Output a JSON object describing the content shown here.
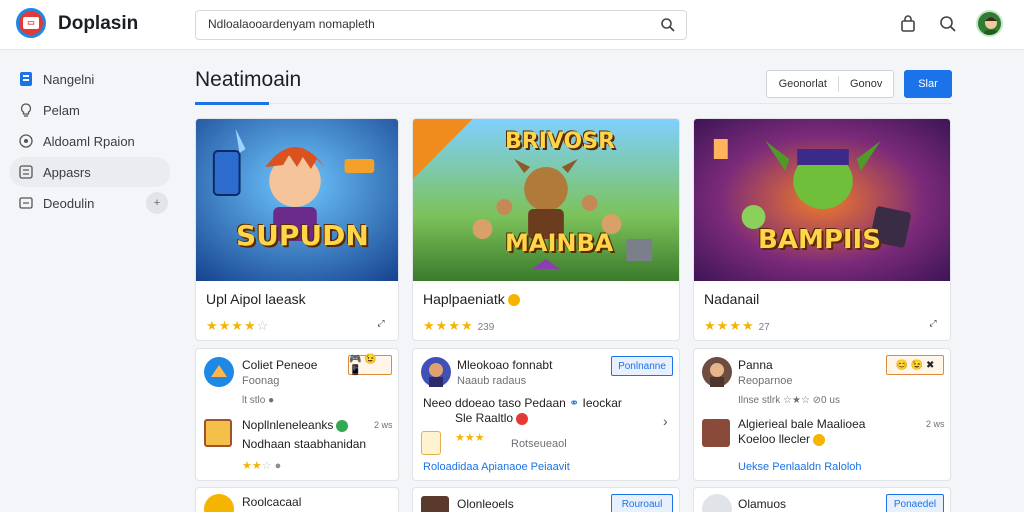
{
  "header": {
    "app_title": "Doplasin",
    "search_value": "Ndloalaooardenyam nomapleth",
    "icons": [
      "logo-icon",
      "search-icon",
      "bag-icon",
      "search-icon",
      "avatar"
    ]
  },
  "sidebar": {
    "items": [
      {
        "label": "Nangelni",
        "icon": "page-icon",
        "active": false
      },
      {
        "label": "Pelam",
        "icon": "bulb-icon",
        "active": false
      },
      {
        "label": "Aldoaml Rpaion",
        "icon": "compass-icon",
        "active": false
      },
      {
        "label": "Appasrs",
        "icon": "apps-icon",
        "active": true
      },
      {
        "label": "Deodulin",
        "icon": "box-icon",
        "active": false,
        "action": "+"
      }
    ]
  },
  "main": {
    "title": "Neatimoain",
    "button_group": [
      "Geonorlat",
      "Gonov"
    ],
    "primary_button": "Slar"
  },
  "featured": [
    {
      "art_title": "SUPUDN",
      "name": "Upl Aipol laeask",
      "stars": 4,
      "rating": "",
      "accent": "#1e4fa8"
    },
    {
      "art_title": "BRIVOSR",
      "art_title2": "MAINBA",
      "name": "Haplpaeniatk",
      "stars": 4,
      "rating": "239",
      "accent": "#3f8f3a"
    },
    {
      "art_title": "BAMPIIS",
      "name": "Nadanail",
      "stars": 4,
      "rating": "27",
      "accent": "#6b2a8a"
    }
  ],
  "lists": [
    {
      "title": "Coliet Peneoe",
      "subtitle": "Foonag",
      "tag": "🎮 😉 📱",
      "meta": "lt stlo",
      "item_title": "Nopllnleneleanks",
      "item_sub": "Nodhaan staabhanidan",
      "item_side": "2 ws",
      "stars_text": "★★☆",
      "bottom_title": "Roolcacaal"
    },
    {
      "title": "Mleokoao fonnabt",
      "subtitle": "Naaub radaus",
      "tag": "Ponlnanne",
      "line1": "Neeo   ddoeao taso Pedaan",
      "line1b": "Ieockar",
      "line2": "Sle Raaltlo",
      "meta_stars": "★★★",
      "item_sub": "Rotseueaol",
      "links": "Roloadidaa Apianaoe Peiaavit",
      "bottom_title": "Olonleoels",
      "bottom_tag": "Rouroaul"
    },
    {
      "title": "Panna",
      "subtitle": "Reoparnoe",
      "tag": "😊 😉 ✖",
      "meta": "Ilnse stlrk ☆★☆ ⊘0 us",
      "item_title": "Algierieal bale Maalioea",
      "item_sub": "Koeloo llecler",
      "item_side": "2 ws",
      "links": "Uekse  Penlaaldn Raloloh",
      "bottom_title": "Olamuos",
      "bottom_tag": "Ponaedel"
    }
  ],
  "colors": {
    "accent": "#1a73e8",
    "star": "#f4b400",
    "background": "#f4f5f8"
  }
}
